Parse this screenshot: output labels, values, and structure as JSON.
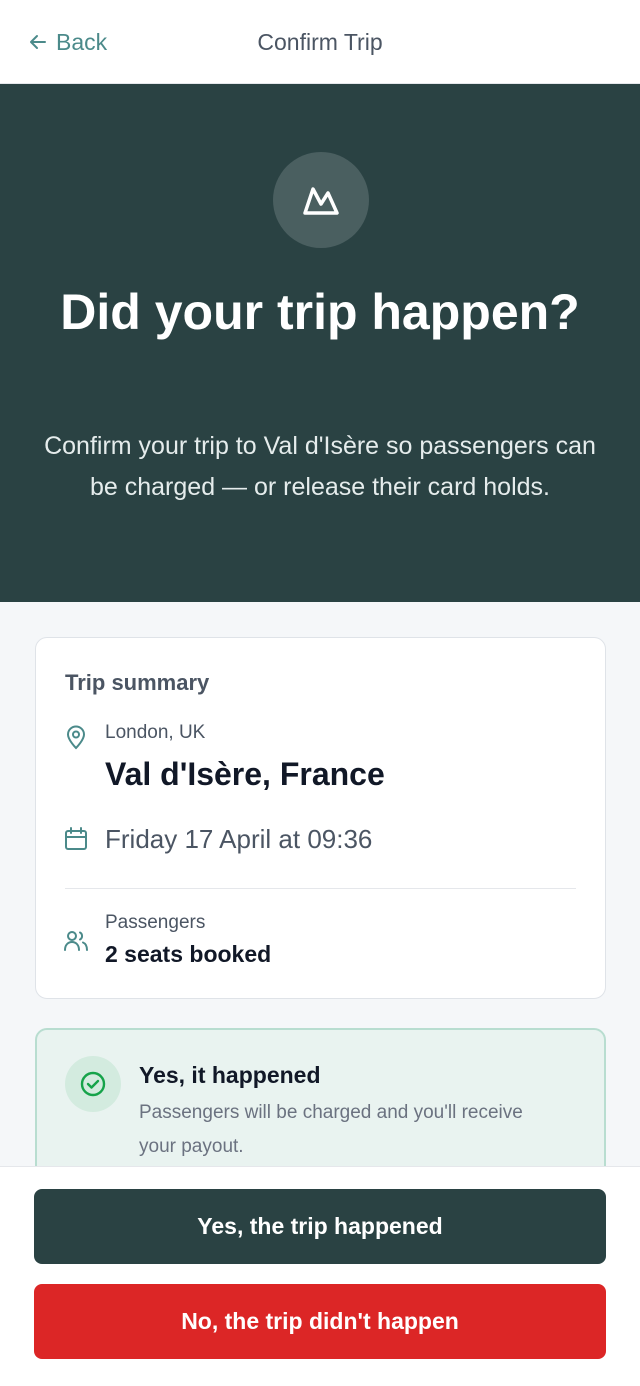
{
  "header": {
    "back_label": "Back",
    "title": "Confirm Trip"
  },
  "hero": {
    "icon": "mountain-icon",
    "title": "Did your trip happen?",
    "subtitle": "Confirm your trip to Val d'Isère so passengers can be charged — or release their card holds."
  },
  "summary": {
    "title": "Trip summary",
    "origin": "London, UK",
    "destination": "Val d'Isère, France",
    "datetime": "Friday 17 April at 09:36",
    "passengers_label": "Passengers",
    "passengers_value": "2 seats booked"
  },
  "option_yes": {
    "title": "Yes, it happened",
    "description": "Passengers will be charged and you'll receive your payout."
  },
  "actions": {
    "confirm_label": "Yes, the trip happened",
    "deny_label": "No, the trip didn't happen"
  },
  "colors": {
    "primary": "#2a4243",
    "accent": "#4b8a8a",
    "danger": "#dc2626",
    "success": "#16a34a"
  }
}
